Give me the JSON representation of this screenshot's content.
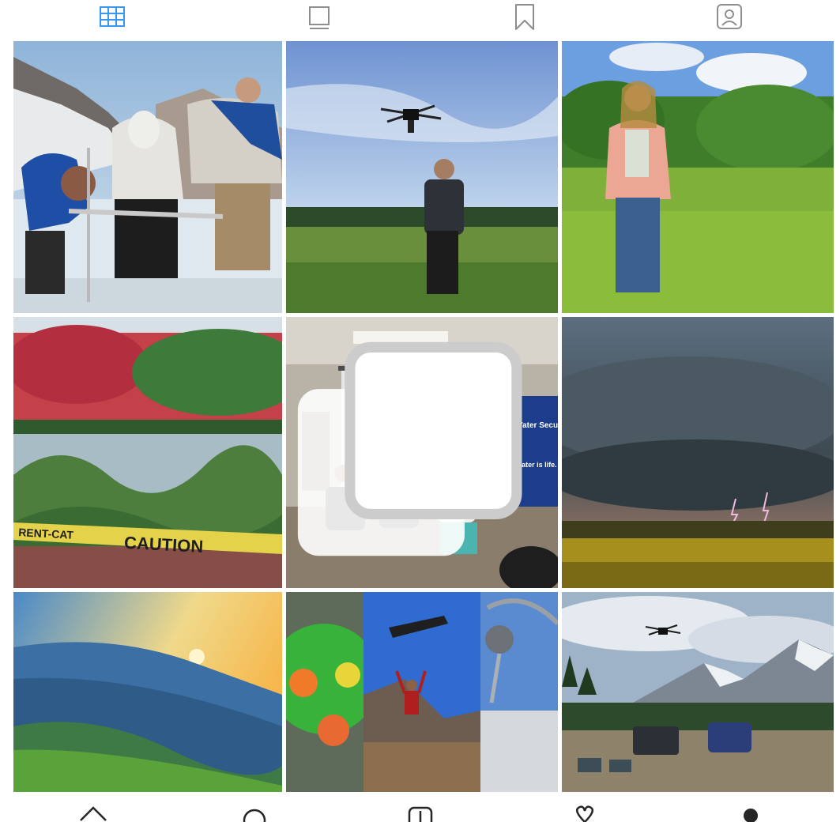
{
  "profile_tabs": [
    {
      "name": "grid",
      "icon": "grid-icon",
      "active": true
    },
    {
      "name": "feed",
      "icon": "feed-icon",
      "active": false
    },
    {
      "name": "saved",
      "icon": "bookmark-icon",
      "active": false
    },
    {
      "name": "tagged",
      "icon": "tagged-icon",
      "active": false
    }
  ],
  "colors": {
    "active": "#3897f0",
    "inactive": "#8e8e8e",
    "text": "#262626"
  },
  "posts": [
    {
      "subject": "glacier-field-crew",
      "multiple": false
    },
    {
      "subject": "drone-over-meadow",
      "multiple": false
    },
    {
      "subject": "woman-in-field",
      "multiple": false
    },
    {
      "subject": "caution-tape-lake",
      "multiple": false
    },
    {
      "subject": "panel-discussion",
      "multiple": true
    },
    {
      "subject": "storm-over-canola",
      "multiple": false
    },
    {
      "subject": "mountain-sunset",
      "multiple": false
    },
    {
      "subject": "research-collage",
      "multiple": false
    },
    {
      "subject": "drone-mountain-camp",
      "multiple": false
    }
  ],
  "screen_text": {
    "caution_tape": "CAUTION",
    "tape_left": "RENT-CAT",
    "banner_title": "Water Security",
    "banner_line": "Water is life."
  },
  "bottom_nav": [
    {
      "name": "home",
      "icon": "home-icon"
    },
    {
      "name": "search",
      "icon": "search-icon"
    },
    {
      "name": "new-post",
      "icon": "add-icon"
    },
    {
      "name": "activity",
      "icon": "heart-icon"
    },
    {
      "name": "profile",
      "icon": "profile-icon"
    }
  ]
}
